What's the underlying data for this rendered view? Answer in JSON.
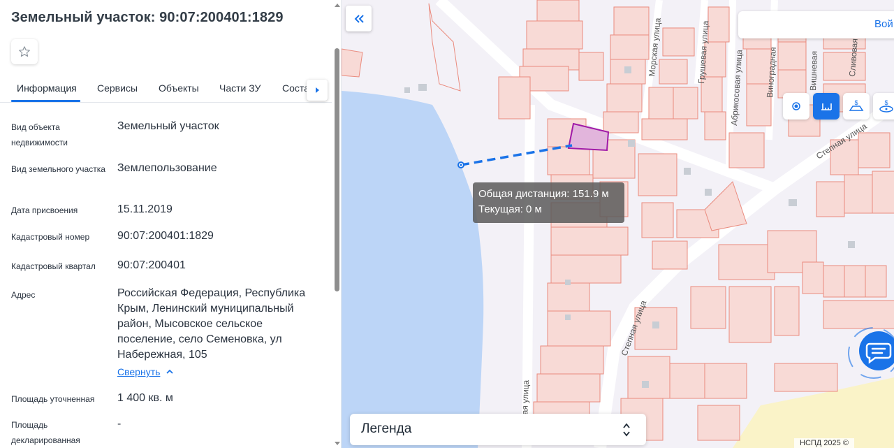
{
  "panel": {
    "title": "Земельный участок: 90:07:200401:1829",
    "tabs": [
      {
        "label": "Информация",
        "active": true
      },
      {
        "label": "Сервисы"
      },
      {
        "label": "Объекты"
      },
      {
        "label": "Части ЗУ"
      },
      {
        "label": "Соста"
      }
    ],
    "rows": [
      {
        "label": "Вид объекта недвижимости",
        "value": "Земельный участок"
      },
      {
        "label": "Вид земельного участка",
        "value": "Землепользование"
      },
      {
        "label": "Дата присвоения",
        "value": "15.11.2019"
      },
      {
        "label": "Кадастровый номер",
        "value": "90:07:200401:1829"
      },
      {
        "label": "Кадастровый квартал",
        "value": "90:07:200401"
      },
      {
        "label": "Адрес",
        "value": "Российская Федерация, Республика Крым, Ленинский муниципальный район, Мысовское сельское поселение, село Семеновка, ул Набережная, 105"
      },
      {
        "label": "Площадь уточненная",
        "value": "1 400 кв. м"
      },
      {
        "label": "Площадь декларированная",
        "value": "-"
      }
    ],
    "collapse_label": "Свернуть"
  },
  "map": {
    "login_label": "Вой",
    "tooltip": {
      "total": "Общая дистанция: 151.9 м",
      "current": "Текущая: 0 м"
    },
    "legend_label": "Легенда",
    "copyright": "НСПД 2025 ©",
    "street_labels": [
      "Морская улица",
      "Грушевая улица",
      "Абрикосовая улица",
      "Виноградная",
      "Вишневая",
      "Сливовая",
      "Степная улица",
      "Степная улица",
      "ная улица"
    ],
    "colors": {
      "accent": "#1a73e8",
      "water": "#bcd5f7",
      "parcel_stroke": "#ea8b7e",
      "parcel_fill": "#f8dad6",
      "selected_parcel": "#a01aa8",
      "measure_line": "#1a73e8"
    }
  }
}
